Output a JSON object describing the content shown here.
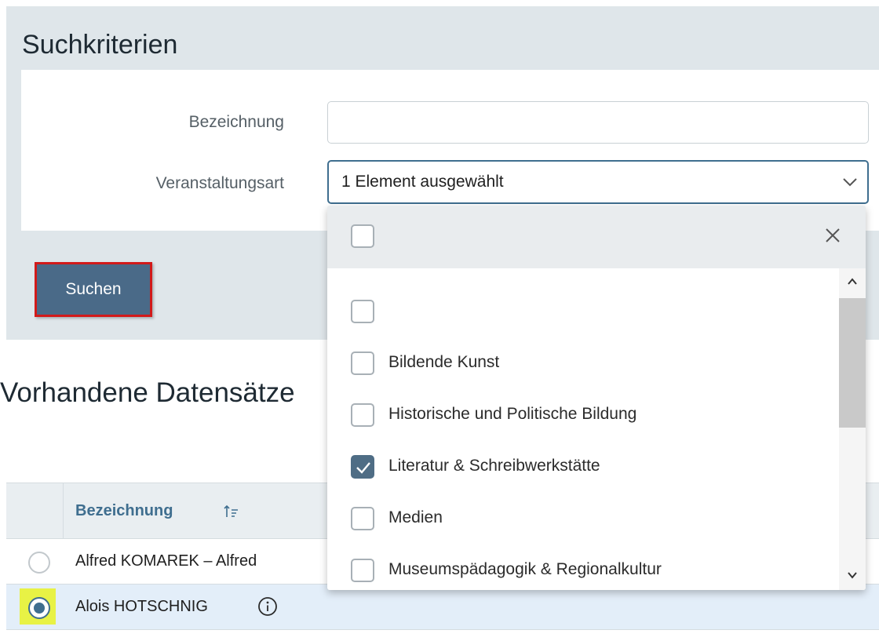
{
  "search_panel": {
    "title": "Suchkriterien",
    "fields": {
      "bezeichnung_label": "Bezeichnung",
      "bezeichnung_value": "",
      "veranstaltungsart_label": "Veranstaltungsart",
      "veranstaltungsart_value": "1 Element ausgewählt"
    },
    "search_button": "Suchen"
  },
  "dropdown": {
    "options": [
      {
        "label": "",
        "checked": false
      },
      {
        "label": "Bildende Kunst",
        "checked": false
      },
      {
        "label": "Historische und Politische Bildung",
        "checked": false
      },
      {
        "label": "Literatur & Schreibwerkstätte",
        "checked": true
      },
      {
        "label": "Medien",
        "checked": false
      },
      {
        "label": "Museumspädagogik & Regionalkultur",
        "checked": false
      }
    ],
    "select_all_checked": false
  },
  "results": {
    "title": "Vorhandene Datensätze",
    "column_header": "Bezeichnung",
    "rows": [
      {
        "name": "Alfred KOMAREK – Alfred",
        "selected": false
      },
      {
        "name": "Alois HOTSCHNIG",
        "selected": true
      }
    ]
  },
  "colors": {
    "accent": "#3f6e8f",
    "button_bg": "#4a6a88",
    "highlight_border": "#d21a1a",
    "selected_row": "#e3eef9",
    "radio_highlight": "#e8f245"
  }
}
